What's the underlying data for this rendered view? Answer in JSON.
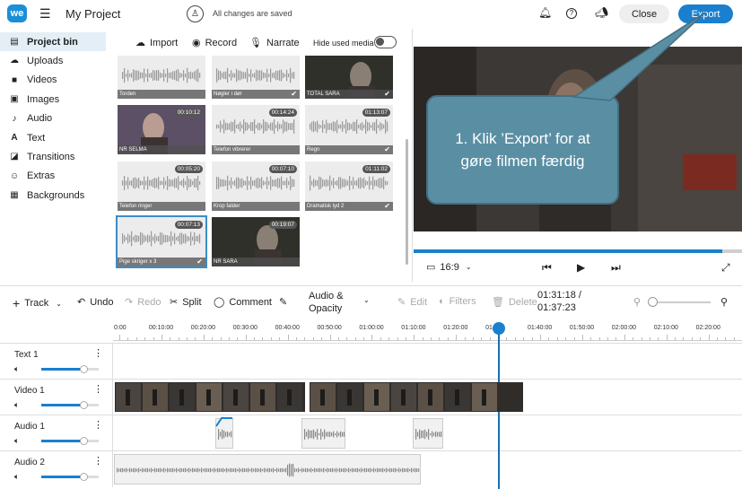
{
  "topbar": {
    "logo": "we",
    "menu_icon": "hamburger-icon",
    "project_title": "My Project",
    "status": "All changes are saved",
    "close_label": "Close",
    "export_label": "Export"
  },
  "sidebar": {
    "items": [
      {
        "label": "Project bin",
        "icon": "project-bin-icon",
        "active": true
      },
      {
        "label": "Uploads",
        "icon": "cloud-upload-icon"
      },
      {
        "label": "Videos",
        "icon": "video-icon"
      },
      {
        "label": "Images",
        "icon": "image-icon"
      },
      {
        "label": "Audio",
        "icon": "music-note-icon"
      },
      {
        "label": "Text",
        "icon": "text-icon"
      },
      {
        "label": "Transitions",
        "icon": "transitions-icon"
      },
      {
        "label": "Extras",
        "icon": "smiley-icon"
      },
      {
        "label": "Backgrounds",
        "icon": "backgrounds-icon"
      }
    ]
  },
  "media_bar": {
    "import_label": "Import",
    "record_label": "Record",
    "narrate_label": "Narrate",
    "hide_used_label": "Hide used media",
    "hide_used_on": false
  },
  "media_grid": {
    "tiles": [
      {
        "caption": "Torden",
        "duration": "",
        "kind": "audio",
        "used": false
      },
      {
        "caption": "Nøgler i dør",
        "duration": "",
        "kind": "audio",
        "used": true
      },
      {
        "caption": "TOTAL SARA",
        "duration": "",
        "kind": "video",
        "used": true
      },
      {
        "caption": "NR SELMA",
        "duration": "00:10:12",
        "kind": "video",
        "used": false
      },
      {
        "caption": "Telefon vibrerer",
        "duration": "00:14:24",
        "kind": "audio",
        "used": false
      },
      {
        "caption": "Regn",
        "duration": "01:13:07",
        "kind": "audio",
        "used": true
      },
      {
        "caption": "Telefon ringer",
        "duration": "00:05:20",
        "kind": "audio",
        "used": false
      },
      {
        "caption": "Krop falder",
        "duration": "00:07:10",
        "kind": "audio",
        "used": false
      },
      {
        "caption": "Dramatisk lyd 2",
        "duration": "01:11:02",
        "kind": "audio",
        "used": true
      },
      {
        "caption": "Pige skriger x 3",
        "duration": "00:07:13",
        "kind": "audio",
        "used": true,
        "selected": true
      },
      {
        "caption": "NR SARA",
        "duration": "00:19:07",
        "kind": "video",
        "used": false
      }
    ]
  },
  "preview": {
    "tooltip": "1. Klik ’Export’ for at gøre filmen færdig",
    "aspect_label": "16:9",
    "progress_fraction": 0.94
  },
  "timeline_toolbar": {
    "track_label": "Track",
    "undo_label": "Undo",
    "redo_label": "Redo",
    "split_label": "Split",
    "comment_label": "Comment",
    "audio_opacity_label": "Audio & Opacity",
    "edit_label": "Edit",
    "filters_label": "Filters",
    "delete_label": "Delete",
    "current_time": "01:31:18 /",
    "total_time": "01:37:23"
  },
  "ruler": {
    "labels": [
      "0:00",
      "00:10:00",
      "00:20:00",
      "00:30:00",
      "00:40:00",
      "00:50:00",
      "01:00:00",
      "01:10:00",
      "01:20:00",
      "01:30",
      "01:40:00",
      "01:50:00",
      "02:00:00",
      "02:10:00",
      "02:20:00"
    ]
  },
  "tracks": [
    {
      "name": "Text 1",
      "volume_fraction": 0.72
    },
    {
      "name": "Video 1",
      "volume_fraction": 0.72
    },
    {
      "name": "Audio 1",
      "volume_fraction": 0.72
    },
    {
      "name": "Audio 2",
      "volume_fraction": 0.72
    }
  ],
  "colors": {
    "accent": "#1a7fce",
    "tooltip_bg": "#5a8fa3",
    "active_nav": "#e3eef7"
  }
}
